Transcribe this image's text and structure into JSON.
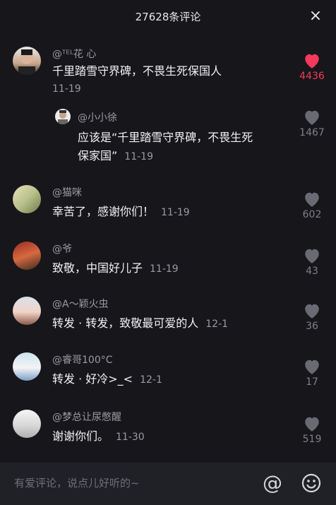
{
  "header": {
    "title": "27628条评论",
    "close_icon": "×"
  },
  "comments": [
    {
      "user": "@ᵀᴱᴸ花 心",
      "text": "千里踏雪守界碑，不畏生死保国人",
      "time": "11-19",
      "likes": "4436",
      "liked": true,
      "reply": {
        "user": "@小小徐",
        "text_line1": "应该是“千里踏雪守界碑，不畏生死",
        "text_line2": "保家国”",
        "time": "11-19",
        "likes": "1467"
      }
    },
    {
      "user": "@猫咪",
      "text": "幸苦了，感谢你们！",
      "time": "11-19",
      "likes": "602"
    },
    {
      "user": "@爷",
      "text": "致敬，中国好儿子",
      "time": "11-19",
      "likes": "43"
    },
    {
      "user": "@A～颖火虫",
      "text": "转发 · 转发，致敬最可爱的人",
      "time": "12-1",
      "likes": "36"
    },
    {
      "user": "@睿哥100°C",
      "text": "转发 · 好冷>_<",
      "time": "12-1",
      "likes": "17"
    },
    {
      "user": "@梦总让尿憋醒",
      "text": "谢谢你们。",
      "time": "11-30",
      "likes": "519"
    }
  ],
  "footer": {
    "placeholder": "有爱评论，说点儿好听的~",
    "at_icon": "@"
  },
  "colors": {
    "liked": "#f6385c",
    "background": "#16161b"
  }
}
